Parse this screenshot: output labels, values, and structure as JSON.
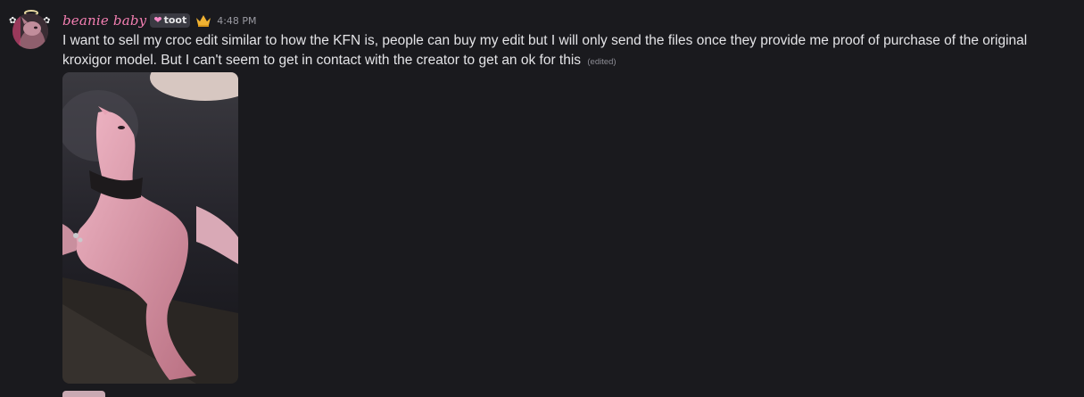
{
  "message": {
    "author": {
      "username": "beanie baby",
      "tag": {
        "icon": "heart-icon",
        "label": "toot",
        "color": "#f78ac8"
      },
      "name_color": "#f47fb2",
      "badge_icon": "crown-icon"
    },
    "timestamp": "4:48 PM",
    "text": "I want to sell my croc edit similar to how the KFN is, people can buy my edit but I will only send the files once they provide me proof of purchase of the original kroxigor model. But I can't seem to get in contact with the creator to get an ok for this",
    "edited_label": "(edited)",
    "attachments": [
      {
        "type": "image"
      },
      {
        "type": "image"
      }
    ]
  },
  "colors": {
    "background": "#1a1a1e",
    "text": "#e4e4e7",
    "muted": "#9a9aa2"
  }
}
